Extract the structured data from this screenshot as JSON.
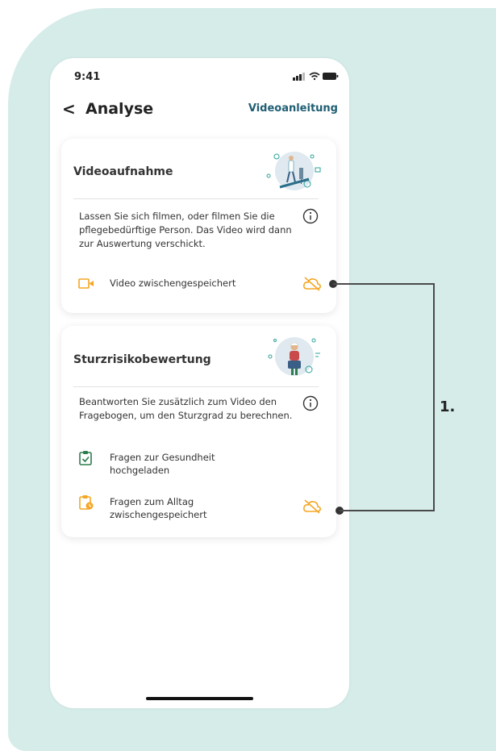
{
  "status_bar": {
    "time": "9:41"
  },
  "header": {
    "back_icon": "chevron-left-icon",
    "title": "Analyse",
    "video_tutorial_link": "Videoanleitung"
  },
  "cards": [
    {
      "title": "Videoaufnahme",
      "description": "Lassen Sie sich filmen, oder filmen Sie die pflegebedürftige Person. Das Video wird dann zur Auswertung verschickt.",
      "items": [
        {
          "icon": "video-camera-icon",
          "label": "Video zwischengespeichert",
          "status_icon": "cloud-off-icon"
        }
      ]
    },
    {
      "title": "Sturzrisikobewertung",
      "description": "Beantworten Sie zusätzlich zum Video den Fragebogen, um den  Sturzgrad zu berechnen.",
      "items": [
        {
          "icon": "clipboard-check-icon",
          "label_line1": "Fragen zur Gesundheit",
          "label_line2": "hochgeladen"
        },
        {
          "icon": "clipboard-clock-icon",
          "label_line1": "Fragen zum Alltag",
          "label_line2": "zwischengespeichert",
          "status_icon": "cloud-off-icon"
        }
      ]
    }
  ],
  "annotation": {
    "label": "1."
  },
  "colors": {
    "accent_green": "#2e7d4f",
    "warning_orange": "#f5a623",
    "link_teal": "#1f5e73",
    "background_mint": "#d5ece9"
  }
}
